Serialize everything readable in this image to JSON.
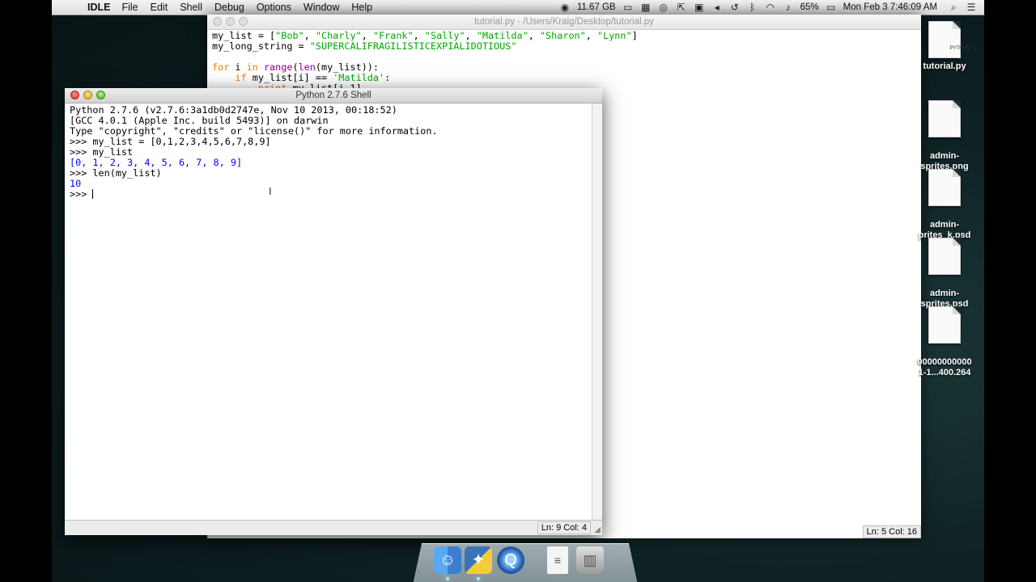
{
  "menubar": {
    "app_name": "IDLE",
    "menus": [
      "File",
      "Edit",
      "Shell",
      "Debug",
      "Options",
      "Window",
      "Help"
    ],
    "memory": "11.67 GB",
    "battery": "65%",
    "datetime": "Mon Feb 3  7:46:09 AM"
  },
  "editor": {
    "title": "tutorial.py - /Users/Kraig/Desktop/tutorial.py",
    "status": "Ln: 5 Col: 16"
  },
  "shell": {
    "title": "Python 2.7.6 Shell",
    "lines": {
      "l1": "Python 2.7.6 (v2.7.6:3a1db0d2747e, Nov 10 2013, 00:18:52) ",
      "l2": "[GCC 4.0.1 (Apple Inc. build 5493)] on darwin",
      "l3": "Type \"copyright\", \"credits\" or \"license()\" for more information.",
      "l4": "my_list = [0,1,2,3,4,5,6,7,8,9]",
      "l5": "my_list",
      "l6": "[0, 1, 2, 3, 4, 5, 6, 7, 8, 9]",
      "l7": "len(my_list)",
      "l8": "10"
    },
    "prompt": ">>> ",
    "status": "Ln: 9 Col: 4"
  },
  "desktop_icons": [
    {
      "label": "tutorial.py",
      "badge": "PYTHON"
    },
    {
      "label": "admin-\nsprites.png"
    },
    {
      "label": "admin-\nprites_k.psd"
    },
    {
      "label": "admin-\nsprites.psd"
    },
    {
      "label": "00000000000\n1-1...400.264"
    }
  ],
  "dock": {
    "items": [
      "finder-icon",
      "python-launcher-icon",
      "quicktime-icon",
      "text-document-icon",
      "trash-icon"
    ]
  }
}
